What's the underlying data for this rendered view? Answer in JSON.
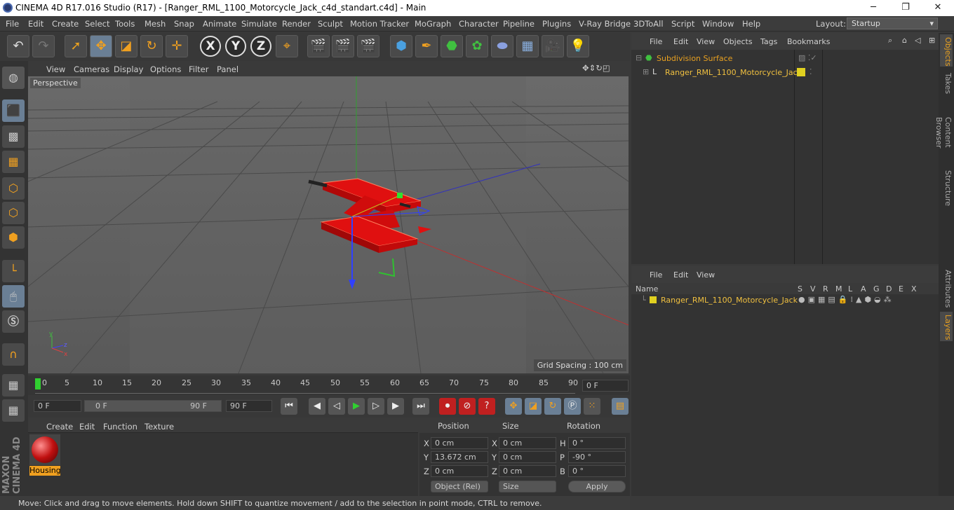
{
  "window": {
    "title": "CINEMA 4D R17.016 Studio (R17) - [Ranger_RML_1100_Motorcycle_Jack_c4d_standart.c4d] - Main",
    "minimize": "─",
    "maximize": "❐",
    "close": "✕"
  },
  "menu": {
    "items": [
      "File",
      "Edit",
      "Create",
      "Select",
      "Tools",
      "Mesh",
      "Snap",
      "Animate",
      "Simulate",
      "Render",
      "Sculpt",
      "Motion Tracker",
      "MoGraph",
      "Character",
      "Pipeline",
      "Plugins",
      "V-Ray Bridge",
      "3DToAll",
      "Script",
      "Window",
      "Help"
    ],
    "layout_label": "Layout:",
    "layout_value": "Startup"
  },
  "toolbar": {
    "undo": "↶",
    "redo": "↷",
    "x": "X",
    "y": "Y",
    "z": "Z"
  },
  "viewport": {
    "menu": [
      "View",
      "Cameras",
      "Display",
      "Options",
      "Filter",
      "Panel"
    ],
    "label": "Perspective",
    "grid_spacing": "Grid Spacing : 100 cm"
  },
  "timeline": {
    "ticks": [
      "0",
      "5",
      "10",
      "15",
      "20",
      "25",
      "30",
      "35",
      "40",
      "45",
      "50",
      "55",
      "60",
      "65",
      "70",
      "75",
      "80",
      "85",
      "90"
    ],
    "frame_field": "0 F"
  },
  "transport": {
    "start": "0 F",
    "range_start": "0 F",
    "range_end": "90 F",
    "end": "90 F"
  },
  "material": {
    "menu": [
      "Create",
      "Edit",
      "Function",
      "Texture"
    ],
    "name": "Housing"
  },
  "coords": {
    "headers": [
      "Position",
      "Size",
      "Rotation"
    ],
    "pos": [
      {
        "axis": "X",
        "value": "0 cm"
      },
      {
        "axis": "Y",
        "value": "13.672 cm"
      },
      {
        "axis": "Z",
        "value": "0 cm"
      }
    ],
    "size": [
      {
        "axis": "X",
        "value": "0 cm"
      },
      {
        "axis": "Y",
        "value": "0 cm"
      },
      {
        "axis": "Z",
        "value": "0 cm"
      }
    ],
    "rot": [
      {
        "axis": "H",
        "value": "0 °"
      },
      {
        "axis": "P",
        "value": "-90 °"
      },
      {
        "axis": "B",
        "value": "0 °"
      }
    ],
    "mode": "Object (Rel)",
    "size_mode": "Size",
    "apply": "Apply"
  },
  "status": "Move: Click and drag to move elements. Hold down SHIFT to quantize movement / add to the selection in point mode, CTRL to remove.",
  "objects": {
    "menu": [
      "File",
      "Edit",
      "View",
      "Objects",
      "Tags",
      "Bookmarks"
    ],
    "items": [
      {
        "name": "Subdivision Surface"
      },
      {
        "name": "Ranger_RML_1100_Motorcycle_Jack"
      }
    ]
  },
  "layers": {
    "menu": [
      "File",
      "Edit",
      "View"
    ],
    "headers": [
      "Name",
      "S",
      "V",
      "R",
      "M",
      "L",
      "A",
      "G",
      "D",
      "E",
      "X"
    ],
    "row": "Ranger_RML_1100_Motorcycle_Jack"
  },
  "side_tabs": [
    "Objects",
    "Takes",
    "Content Browser",
    "Structure",
    "Attributes",
    "Layers"
  ],
  "brand": "MAXON CINEMA 4D",
  "colors": {
    "accent_orange": "#e8a020",
    "jack_red": "#e01010",
    "layer_yellow": "#e0d020"
  }
}
